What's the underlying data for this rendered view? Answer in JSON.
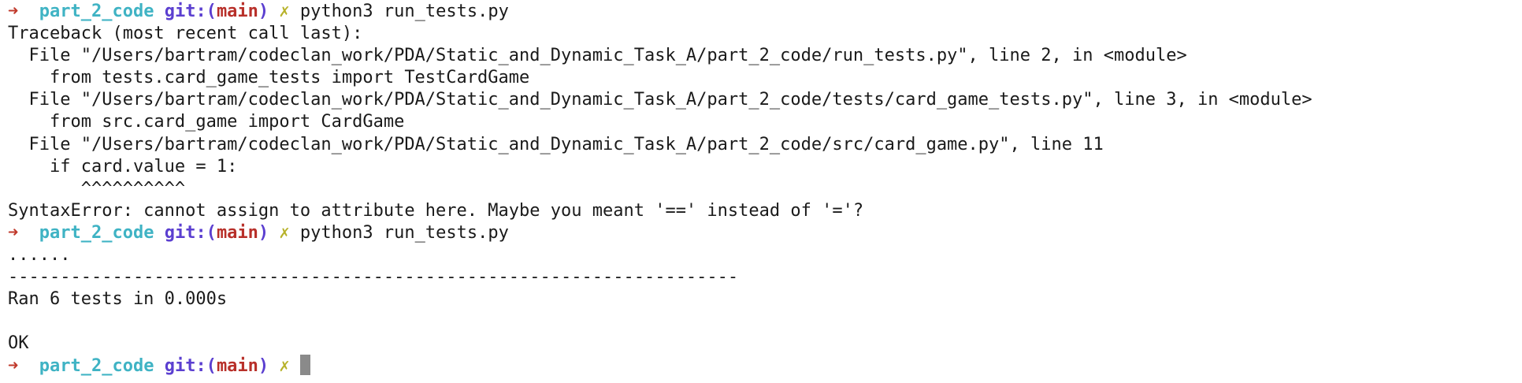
{
  "prompt": {
    "arrow": "➜",
    "dir": "part_2_code",
    "git_label": "git:(",
    "branch": "main",
    "git_close": ")",
    "dirty": "✗"
  },
  "commands": {
    "first": "python3 run_tests.py",
    "second": "python3 run_tests.py"
  },
  "output": {
    "traceback_header": "Traceback (most recent call last):",
    "file1": "  File \"/Users/bartram/codeclan_work/PDA/Static_and_Dynamic_Task_A/part_2_code/run_tests.py\", line 2, in <module>",
    "code1": "    from tests.card_game_tests import TestCardGame",
    "file2": "  File \"/Users/bartram/codeclan_work/PDA/Static_and_Dynamic_Task_A/part_2_code/tests/card_game_tests.py\", line 3, in <module>",
    "code2": "    from src.card_game import CardGame",
    "file3": "  File \"/Users/bartram/codeclan_work/PDA/Static_and_Dynamic_Task_A/part_2_code/src/card_game.py\", line 11",
    "code3": "    if card.value = 1:",
    "caret": "       ^^^^^^^^^^",
    "syntax_error": "SyntaxError: cannot assign to attribute here. Maybe you meant '==' instead of '='?",
    "dots": "......",
    "separator": "----------------------------------------------------------------------",
    "ran": "Ran 6 tests in 0.000s",
    "blank": "",
    "ok": "OK"
  }
}
